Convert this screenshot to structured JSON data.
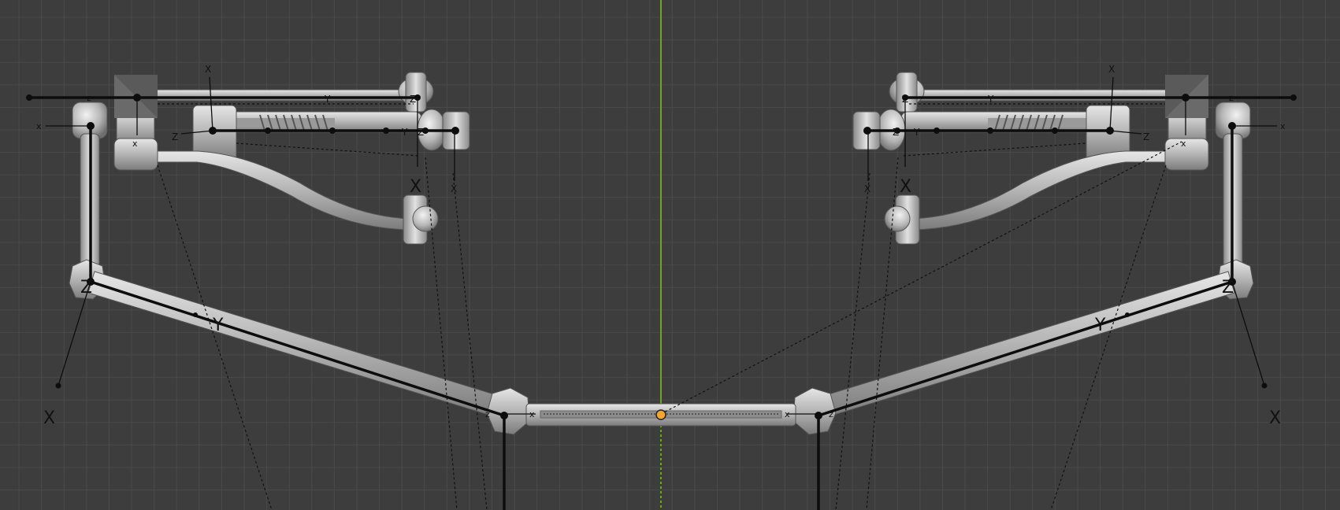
{
  "viewport": {
    "grid_color": "#4a4a4a",
    "background_color": "#3d3d3d",
    "center_axis_color": "#6fa322",
    "origin_color": "#f6a431",
    "bone_color": "#0d0d0d",
    "mesh_color": "#b8b8b8"
  },
  "axis_labels": {
    "x_upper": "X",
    "y_upper": "Y",
    "z_upper": "Z",
    "x_lower": "x",
    "z_lower": "z"
  }
}
